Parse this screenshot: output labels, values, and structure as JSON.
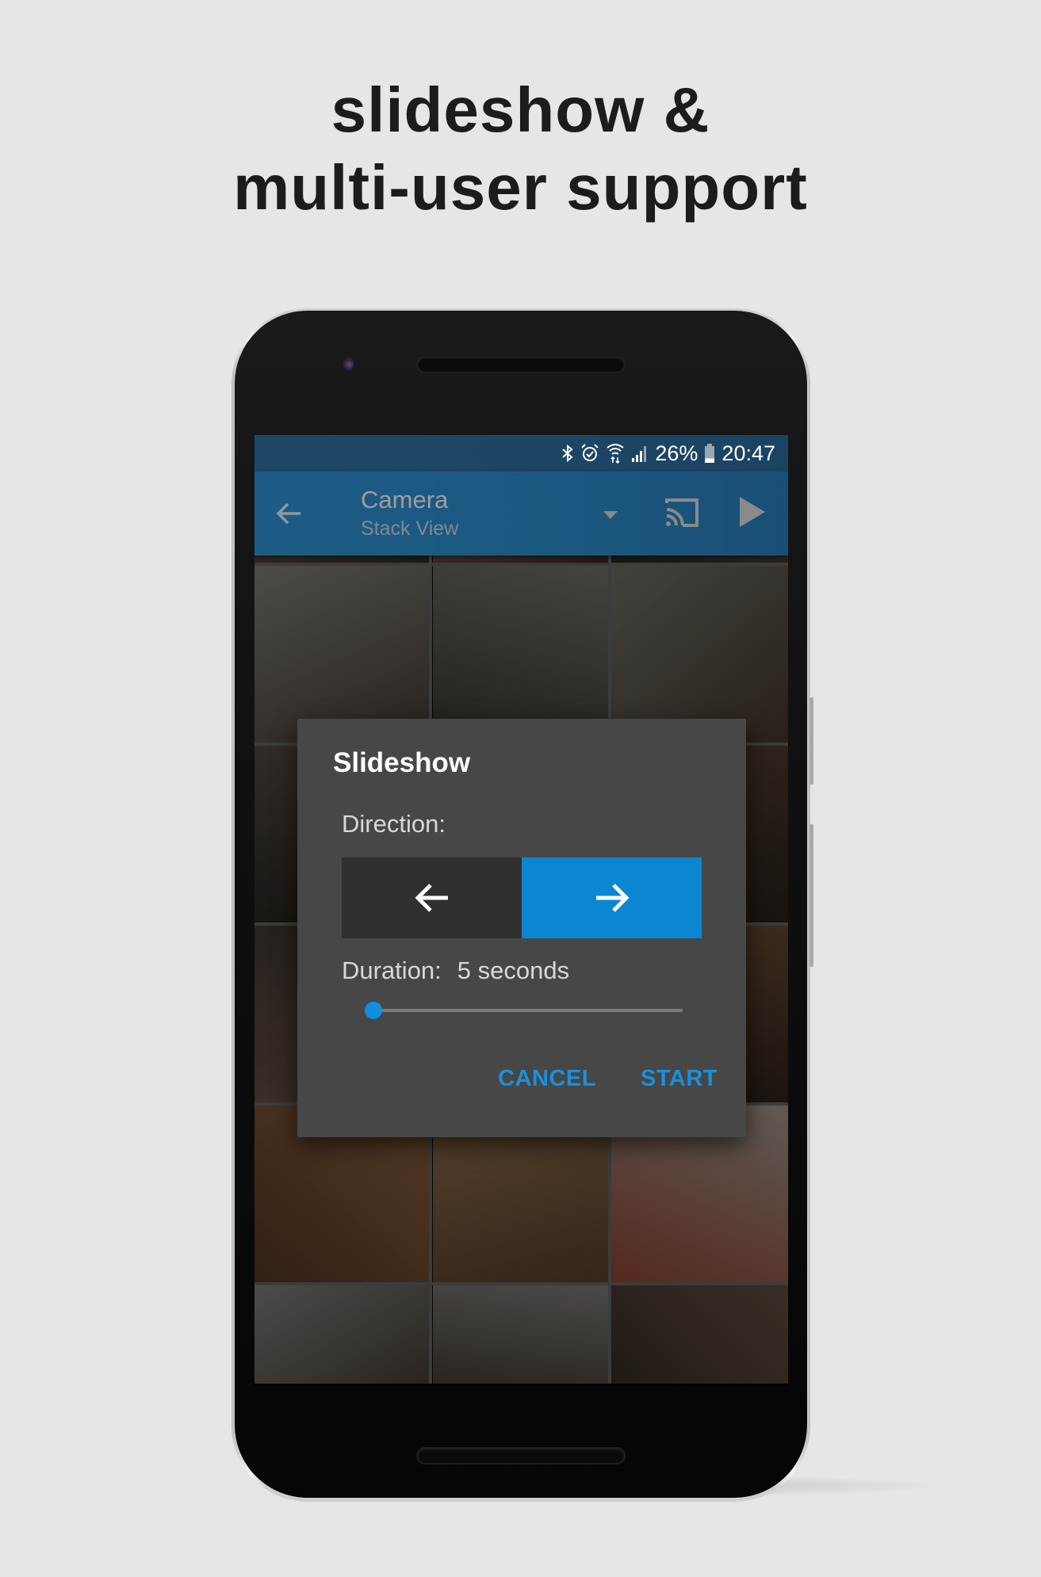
{
  "headline": {
    "line1": "slideshow &",
    "line2": "multi-user support"
  },
  "status_bar": {
    "icons": [
      "bluetooth-icon",
      "alarm-icon",
      "wifi-icon",
      "signal-icon",
      "battery-icon"
    ],
    "battery_percent": "26%",
    "battery_level": 0.26,
    "time": "20:47"
  },
  "app_bar": {
    "back_icon": "arrow-back-icon",
    "title": "Camera",
    "subtitle": "Stack View",
    "dropdown_icon": "dropdown-arrow-icon",
    "cast_icon": "cast-icon",
    "play_icon": "play-icon",
    "color": "#1d5c86"
  },
  "photo_grid": {
    "columns": 3,
    "tiles": [
      {
        "row": 0,
        "col": 0,
        "desc": "partial photo"
      },
      {
        "row": 0,
        "col": 1,
        "desc": "partial photo"
      },
      {
        "row": 0,
        "col": 2,
        "desc": "partial photo"
      },
      {
        "row": 1,
        "col": 0,
        "desc": "family room with children"
      },
      {
        "row": 1,
        "col": 1,
        "desc": "christmas tree by window"
      },
      {
        "row": 1,
        "col": 2,
        "desc": "christmas tree by window"
      },
      {
        "row": 2,
        "col": 0,
        "desc": "man in sweater"
      },
      {
        "row": 2,
        "col": 1,
        "desc": "photo"
      },
      {
        "row": 2,
        "col": 2,
        "desc": "man in suit"
      },
      {
        "row": 3,
        "col": 0,
        "desc": "woman standing"
      },
      {
        "row": 3,
        "col": 1,
        "desc": "photo"
      },
      {
        "row": 3,
        "col": 2,
        "desc": "room"
      },
      {
        "row": 4,
        "col": 0,
        "desc": "child on floor"
      },
      {
        "row": 4,
        "col": 1,
        "desc": "child and grandmother"
      },
      {
        "row": 4,
        "col": 2,
        "desc": "gifts on table"
      },
      {
        "row": 5,
        "col": 0,
        "desc": "three men with candle arches"
      },
      {
        "row": 5,
        "col": 1,
        "desc": "three men with candle arches"
      },
      {
        "row": 5,
        "col": 2,
        "desc": "wooden christmas pyramid"
      }
    ]
  },
  "dialog": {
    "title": "Slideshow",
    "direction_label": "Direction:",
    "direction_options": [
      {
        "icon": "arrow-left-icon",
        "value": "backward",
        "selected": false
      },
      {
        "icon": "arrow-right-icon",
        "value": "forward",
        "selected": true
      }
    ],
    "duration_label": "Duration:",
    "duration_value": "5 seconds",
    "duration_slider_fraction": 0.0,
    "cancel_label": "CANCEL",
    "start_label": "START",
    "accent_color": "#0b87d2"
  }
}
